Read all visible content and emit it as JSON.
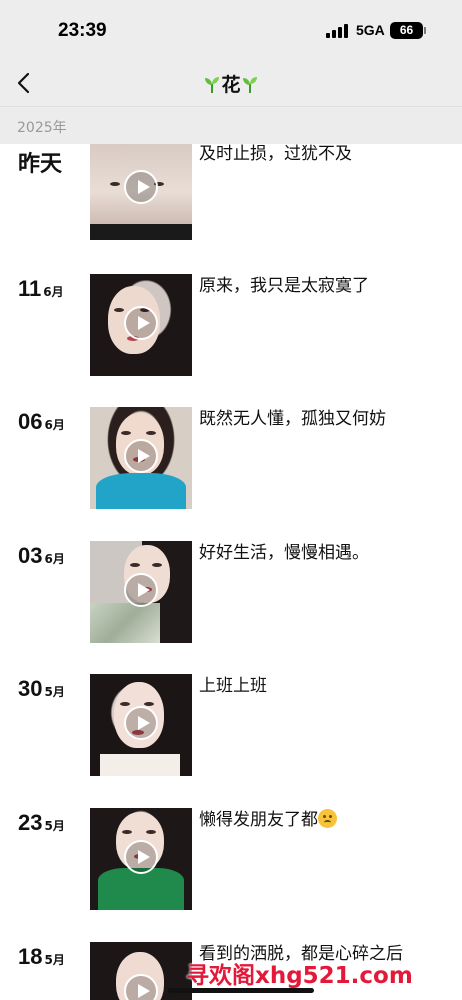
{
  "status_bar": {
    "time": "23:39",
    "network": "5GA",
    "battery": "66"
  },
  "nav": {
    "title": "花",
    "back_icon": "chevron-left-icon"
  },
  "year_header": "2025年",
  "posts": [
    {
      "day": "昨天",
      "month": "",
      "caption": "及时止损，过犹不及"
    },
    {
      "day": "11",
      "month": "6月",
      "caption": "原来，我只是太寂寞了"
    },
    {
      "day": "06",
      "month": "6月",
      "caption": "既然无人懂，孤独又何妨"
    },
    {
      "day": "03",
      "month": "6月",
      "caption": "好好生活，慢慢相遇。"
    },
    {
      "day": "30",
      "month": "5月",
      "caption": "上班上班"
    },
    {
      "day": "23",
      "month": "5月",
      "caption": "懒得发朋友了都"
    },
    {
      "day": "18",
      "month": "5月",
      "caption": "看到的洒脱，都是心碎之后"
    }
  ],
  "watermark": "寻欢阁xhg521.com",
  "colors": {
    "nav_background": "#ededed",
    "year_text": "#999999",
    "watermark": "#e4193a"
  }
}
